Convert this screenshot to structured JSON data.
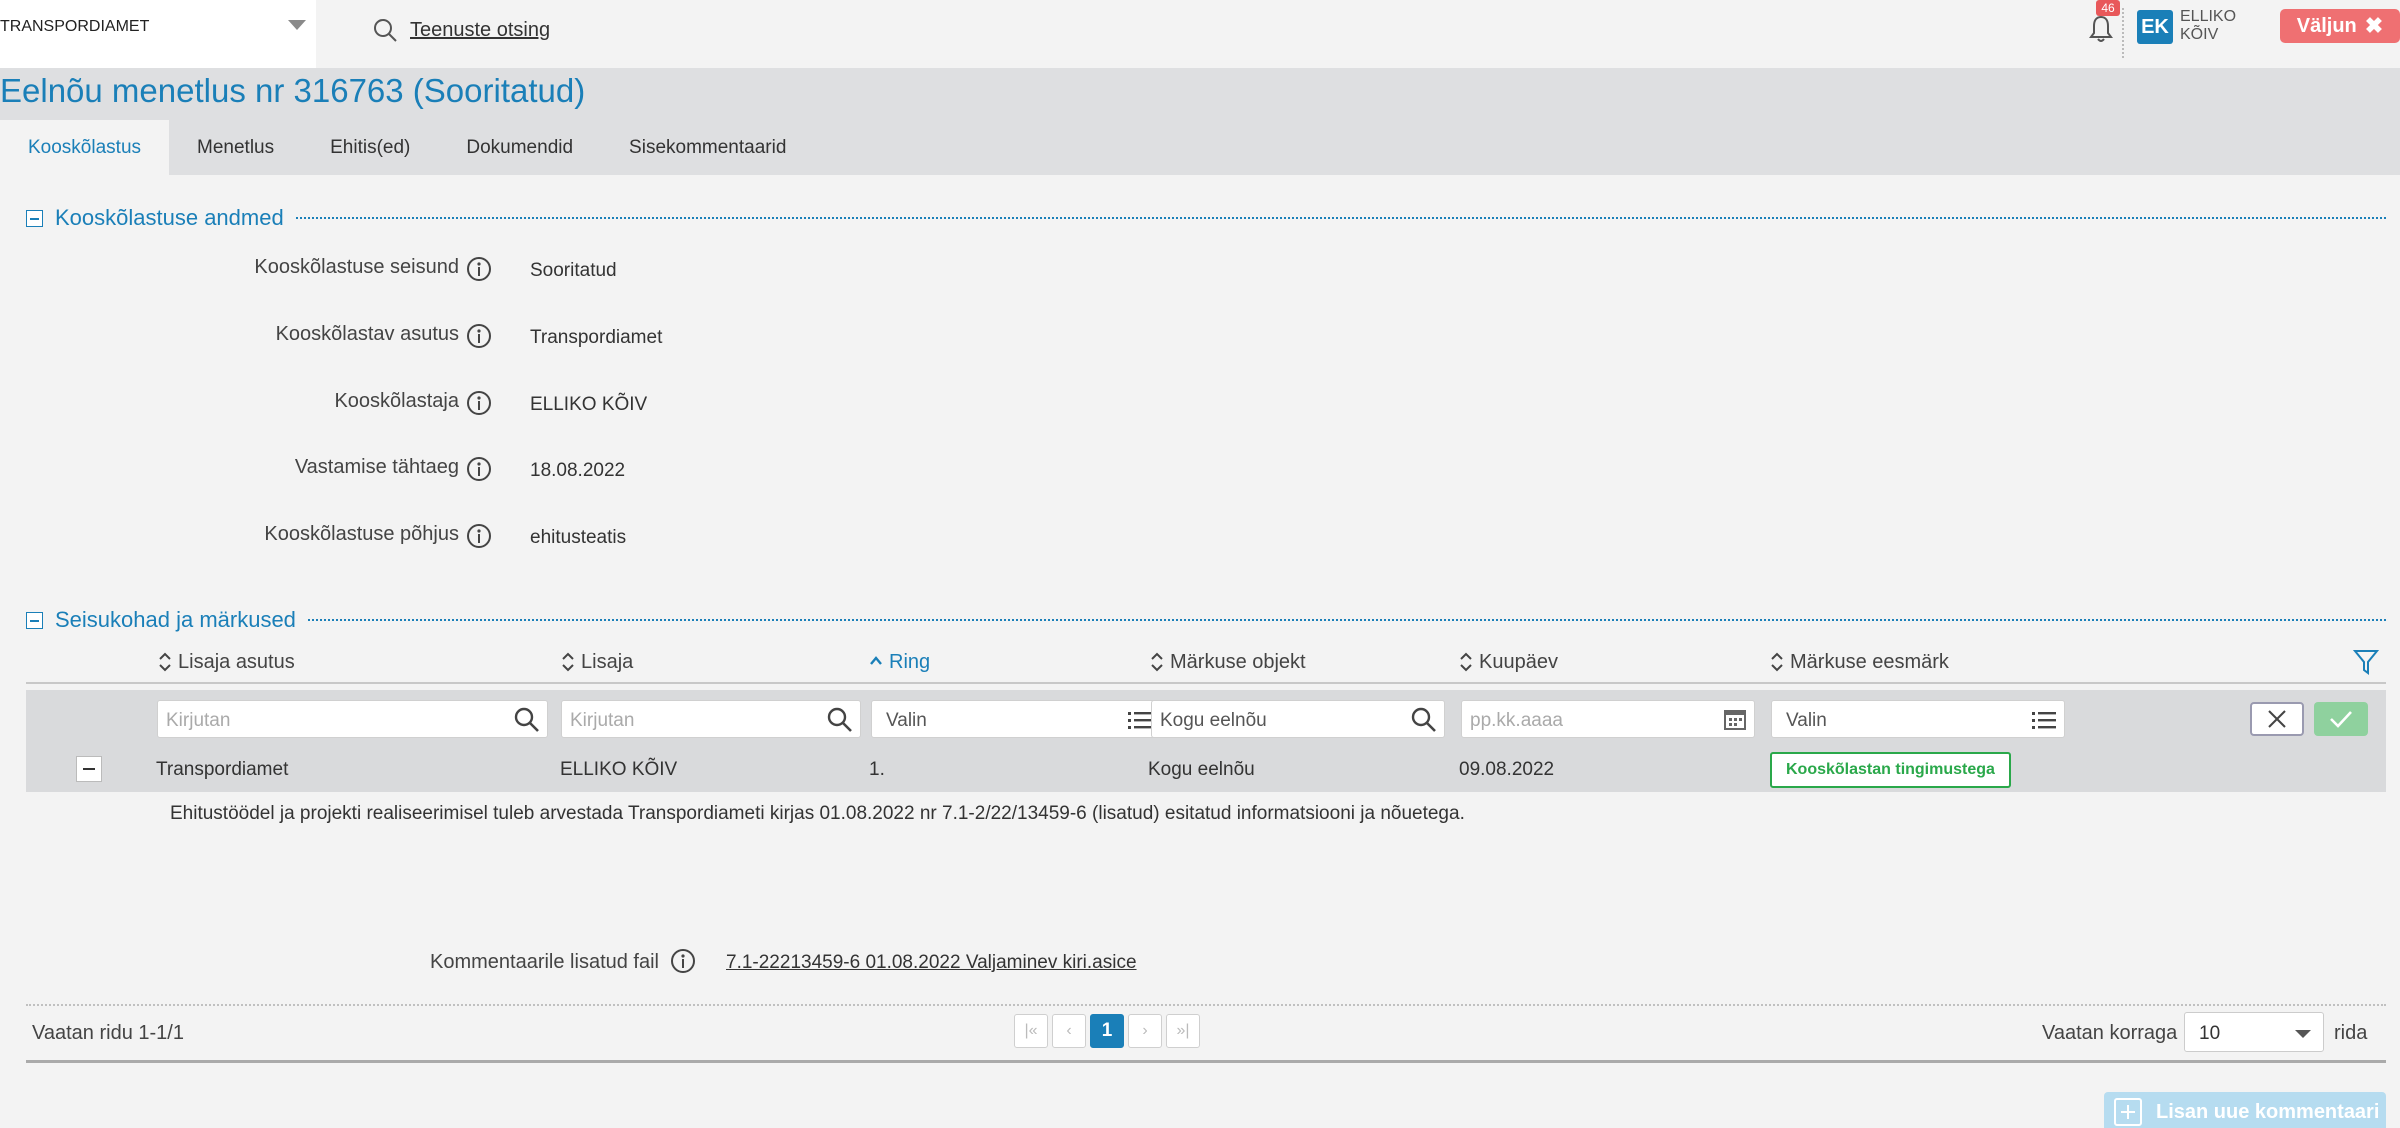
{
  "header": {
    "organization": "TRANSPORDIAMET",
    "search_label": "Teenuste otsing",
    "notification_count": "46",
    "user_initials": "EK",
    "user_first_name": "ELLIKO",
    "user_last_name": "KÕIV",
    "logout_label": "Väljun"
  },
  "page": {
    "title": "Eelnõu menetlus nr 316763 (Sooritatud)",
    "tabs": [
      {
        "label": "Kooskõlastus",
        "active": true
      },
      {
        "label": "Menetlus"
      },
      {
        "label": "Ehitis(ed)"
      },
      {
        "label": "Dokumendid"
      },
      {
        "label": "Sisekommentaarid"
      }
    ]
  },
  "approval_section": {
    "title": "Kooskõlastuse andmed",
    "fields": [
      {
        "label": "Kooskõlastuse seisund",
        "value": "Sooritatud"
      },
      {
        "label": "Kooskõlastav asutus",
        "value": "Transpordiamet"
      },
      {
        "label": "Kooskõlastaja",
        "value": "ELLIKO KÕIV"
      },
      {
        "label": "Vastamise tähtaeg",
        "value": "18.08.2022"
      },
      {
        "label": "Kooskõlastuse põhjus",
        "value": "ehitusteatis"
      }
    ]
  },
  "remarks_section": {
    "title": "Seisukohad ja märkused",
    "columns": [
      {
        "label": "Lisaja asutus"
      },
      {
        "label": "Lisaja"
      },
      {
        "label": "Ring",
        "sorted": "asc"
      },
      {
        "label": "Märkuse objekt"
      },
      {
        "label": "Kuupäev"
      },
      {
        "label": "Märkuse eesmärk"
      }
    ],
    "filters": {
      "adder_org": "Kirjutan",
      "adder": "Kirjutan",
      "round": "Valin",
      "object": "Kogu eelnõu",
      "date_placeholder": "pp.kk.aaaa",
      "purpose": "Valin"
    },
    "row": {
      "adder_org": "Transpordiamet",
      "adder": "ELLIKO KÕIV",
      "round": "1.",
      "object": "Kogu eelnõu",
      "date": "09.08.2022",
      "purpose": "Kooskõlastan tingimustega",
      "comment": "Ehitustöödel ja projekti realiseerimisel tuleb arvestada Transpordiameti kirjas 01.08.2022 nr 7.1-2/22/13459-6 (lisatud) esitatud informatsiooni ja nõuetega.",
      "attachment_label": "Kommentaarile lisatud fail",
      "attachment_file": "7.1-22213459-6 01.08.2022 Valjaminev kiri.asice"
    },
    "pagination": {
      "rows_info": "Vaatan ridu 1-1/1",
      "first": "|«",
      "prev": "‹",
      "current_page": "1",
      "next": "›",
      "last": "»|",
      "per_page_label": "Vaatan korraga",
      "per_page_value": "10",
      "per_page_suffix": "rida"
    },
    "add_comment_label": "Lisan uue kommentaari"
  },
  "colors": {
    "accent": "#1a7fb8",
    "success": "#2aa84a",
    "danger": "#ef7072"
  }
}
